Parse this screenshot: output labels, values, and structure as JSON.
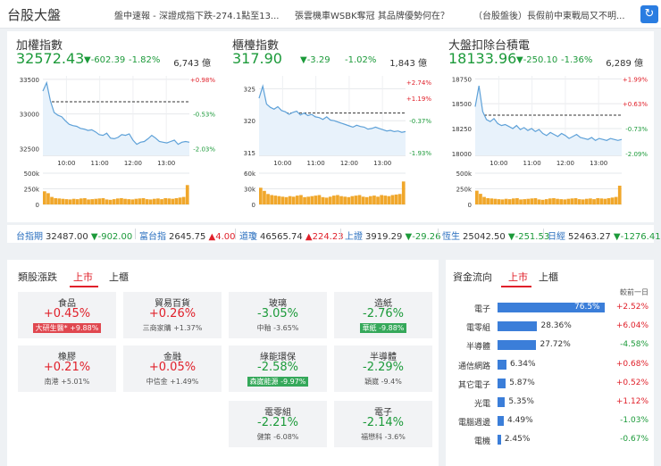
{
  "header": {
    "title": "台股大盤",
    "news": [
      "盤中速報 - 深證成指下跌-274.1點至13...",
      "張雲機車WSBK奪冠 其品牌優勢何在？",
      "（台股盤後）長假前中東戰局又不明..."
    ],
    "refresh_icon": "refresh-icon"
  },
  "panels": [
    {
      "name": "加權指數",
      "price": "32572.43",
      "change": "▼-602.39",
      "percent": "-1.82%",
      "volume": "6,743 億",
      "chart": {
        "ylim": [
          32400,
          33550
        ],
        "prev_close": 33175,
        "y_ticks": [
          {
            "v": 33500,
            "l": "33500"
          },
          {
            "v": 33000,
            "l": "33000"
          },
          {
            "v": 32500,
            "l": "32500"
          }
        ],
        "r_ticks": [
          {
            "v": 33500,
            "l": "+0.98%",
            "c": "up"
          },
          {
            "v": 33000,
            "l": "-0.53%",
            "c": "down"
          },
          {
            "v": 32500,
            "l": "-2.03%",
            "c": "down"
          }
        ],
        "x_ticks": [
          "10:00",
          "11:00",
          "12:00",
          "13:00"
        ],
        "vol_ticks": [
          "500k",
          "250k",
          "0"
        ],
        "vol_max": 500,
        "series": [
          33330,
          33450,
          33190,
          33020,
          32980,
          32960,
          32900,
          32850,
          32830,
          32820,
          32790,
          32780,
          32760,
          32770,
          32740,
          32700,
          32690,
          32720,
          32650,
          32640,
          32660,
          32700,
          32690,
          32710,
          32620,
          32560,
          32590,
          32600,
          32640,
          32690,
          32650,
          32600,
          32590,
          32580,
          32600,
          32620,
          32560,
          32590,
          32600,
          32590
        ],
        "volume": [
          210,
          180,
          120,
          100,
          95,
          90,
          85,
          80,
          90,
          85,
          95,
          100,
          80,
          85,
          90,
          95,
          100,
          80,
          75,
          85,
          95,
          100,
          90,
          85,
          80,
          90,
          95,
          100,
          85,
          80,
          90,
          95,
          85,
          100,
          95,
          90,
          100,
          110,
          120,
          310
        ]
      }
    },
    {
      "name": "櫃檯指數",
      "price": "317.90",
      "change": "▼-3.29",
      "percent": "-1.02%",
      "volume": "1,843 億",
      "chart": {
        "ylim": [
          314.6,
          327
        ],
        "prev_close": 321.2,
        "y_ticks": [
          {
            "v": 325,
            "l": "325"
          },
          {
            "v": 320,
            "l": "320"
          },
          {
            "v": 315,
            "l": "315"
          }
        ],
        "r_ticks": [
          {
            "v": 326,
            "l": "+2.74%",
            "c": "up"
          },
          {
            "v": 323.5,
            "l": "+1.19%",
            "c": "up"
          },
          {
            "v": 320,
            "l": "-0.37%",
            "c": "down"
          },
          {
            "v": 315,
            "l": "-1.93%",
            "c": "down"
          }
        ],
        "x_ticks": [
          "10:00",
          "11:00",
          "12:00",
          "13:00"
        ],
        "vol_ticks": [
          "60k",
          "30k",
          "0"
        ],
        "vol_max": 60,
        "series": [
          323.5,
          325.4,
          322.6,
          322.1,
          321.8,
          322.2,
          321.6,
          321.4,
          321.0,
          321.3,
          321.5,
          320.9,
          321.2,
          320.8,
          321.0,
          320.6,
          320.5,
          320.2,
          320.6,
          320.1,
          320.0,
          319.8,
          319.6,
          319.4,
          319.2,
          319.0,
          319.3,
          319.1,
          319.0,
          318.7,
          318.8,
          319.0,
          318.8,
          318.6,
          318.4,
          318.5,
          318.3,
          318.4,
          318.2,
          318.3
        ],
        "volume": [
          32,
          26,
          20,
          18,
          17,
          16,
          15,
          14,
          16,
          15,
          17,
          18,
          14,
          15,
          16,
          17,
          18,
          14,
          13,
          15,
          17,
          18,
          16,
          15,
          14,
          16,
          17,
          18,
          15,
          14,
          16,
          17,
          15,
          18,
          17,
          16,
          18,
          19,
          20,
          44
        ]
      }
    },
    {
      "name": "大盤扣除台積電",
      "price": "18133.96",
      "change": "▼-250.10",
      "percent": "-1.36%",
      "volume": "6,289 億",
      "chart": {
        "ylim": [
          17980,
          18780
        ],
        "prev_close": 18385,
        "y_ticks": [
          {
            "v": 18750,
            "l": "18750"
          },
          {
            "v": 18500,
            "l": "18500"
          },
          {
            "v": 18250,
            "l": "18250"
          },
          {
            "v": 18000,
            "l": "18000"
          }
        ],
        "r_ticks": [
          {
            "v": 18750,
            "l": "+1.99%",
            "c": "up"
          },
          {
            "v": 18500,
            "l": "+0.63%",
            "c": "up"
          },
          {
            "v": 18250,
            "l": "-0.73%",
            "c": "down"
          },
          {
            "v": 18000,
            "l": "-2.09%",
            "c": "down"
          }
        ],
        "x_ticks": [
          "10:00",
          "11:00",
          "12:00",
          "13:00"
        ],
        "vol_ticks": [
          "500k",
          "250k",
          "0"
        ],
        "vol_max": 500,
        "series": [
          18470,
          18680,
          18420,
          18340,
          18320,
          18350,
          18300,
          18280,
          18290,
          18270,
          18250,
          18280,
          18240,
          18260,
          18230,
          18250,
          18220,
          18240,
          18200,
          18180,
          18210,
          18190,
          18170,
          18200,
          18180,
          18150,
          18170,
          18190,
          18160,
          18150,
          18140,
          18160,
          18130,
          18150,
          18140,
          18130,
          18150,
          18140,
          18130,
          18140
        ],
        "volume": [
          220,
          170,
          120,
          100,
          95,
          90,
          85,
          80,
          90,
          85,
          95,
          100,
          80,
          85,
          90,
          95,
          100,
          80,
          75,
          85,
          95,
          100,
          90,
          85,
          80,
          90,
          95,
          100,
          85,
          80,
          90,
          95,
          85,
          100,
          95,
          90,
          100,
          110,
          120,
          300
        ]
      }
    }
  ],
  "strip": [
    {
      "label": "台指期",
      "value": "32487.00",
      "change": "▼-902.00",
      "dir": "down"
    },
    {
      "label": "富台指",
      "value": "2645.75",
      "change": "▲4.00",
      "dir": "up"
    },
    {
      "label": "道瓊",
      "value": "46565.74",
      "change": "▲224.23",
      "dir": "up"
    },
    {
      "label": "上證",
      "value": "3919.29",
      "change": "▼-29.26",
      "dir": "down"
    },
    {
      "label": "恆生",
      "value": "25042.50",
      "change": "▼-251.53",
      "dir": "down"
    },
    {
      "label": "日經",
      "value": "52463.27",
      "change": "▼-1276.41",
      "dir": "down"
    }
  ],
  "sectors": {
    "title": "類股漲跌",
    "tabs": [
      "上市",
      "上櫃"
    ],
    "cards": [
      {
        "name": "食品",
        "pct": "+0.45%",
        "dir": "up",
        "stock": "大研生醫*",
        "stock_chg": "+9.88%",
        "badge": true
      },
      {
        "name": "貿易百貨",
        "pct": "+0.26%",
        "dir": "up",
        "stock": "三商家購",
        "stock_chg": "+1.37%",
        "badge": false
      },
      {
        "name": "玻璃",
        "pct": "-3.05%",
        "dir": "down",
        "stock": "中釉",
        "stock_chg": "-3.65%",
        "badge": false
      },
      {
        "name": "造紙",
        "pct": "-2.76%",
        "dir": "down",
        "stock": "華紙",
        "stock_chg": "-9.88%",
        "badge": true
      },
      {
        "name": "橡膠",
        "pct": "+0.21%",
        "dir": "up",
        "stock": "南港",
        "stock_chg": "+5.01%",
        "badge": false
      },
      {
        "name": "金融",
        "pct": "+0.05%",
        "dir": "up",
        "stock": "中信金",
        "stock_chg": "+1.49%",
        "badge": false
      },
      {
        "name": "綠能環保",
        "pct": "-2.58%",
        "dir": "down",
        "stock": "森崴能源",
        "stock_chg": "-9.97%",
        "badge": true
      },
      {
        "name": "半導體",
        "pct": "-2.29%",
        "dir": "down",
        "stock": "穎崴",
        "stock_chg": "-9.4%",
        "badge": false
      },
      {
        "name": "電零組",
        "pct": "-2.21%",
        "dir": "down",
        "stock": "健策",
        "stock_chg": "-6.08%",
        "badge": false
      },
      {
        "name": "電子",
        "pct": "-2.14%",
        "dir": "down",
        "stock": "福懋科",
        "stock_chg": "-3.6%",
        "badge": false
      }
    ]
  },
  "flow": {
    "title": "資金流向",
    "tabs": [
      "上市",
      "上櫃"
    ],
    "unit": "較前一日",
    "rows": [
      {
        "name": "電子",
        "pct": 76.5,
        "pct_label": "76.5%",
        "change": "+2.52%",
        "dir": "up"
      },
      {
        "name": "電零組",
        "pct": 28.36,
        "pct_label": "28.36%",
        "change": "+6.04%",
        "dir": "up"
      },
      {
        "name": "半導體",
        "pct": 27.72,
        "pct_label": "27.72%",
        "change": "-4.58%",
        "dir": "down"
      },
      {
        "name": "通信網路",
        "pct": 6.34,
        "pct_label": "6.34%",
        "change": "+0.68%",
        "dir": "up"
      },
      {
        "name": "其它電子",
        "pct": 5.87,
        "pct_label": "5.87%",
        "change": "+0.52%",
        "dir": "up"
      },
      {
        "name": "光電",
        "pct": 5.35,
        "pct_label": "5.35%",
        "change": "+1.12%",
        "dir": "up"
      },
      {
        "name": "電腦週邊",
        "pct": 4.49,
        "pct_label": "4.49%",
        "change": "-1.03%",
        "dir": "down"
      },
      {
        "name": "電機",
        "pct": 2.45,
        "pct_label": "2.45%",
        "change": "-0.67%",
        "dir": "down"
      }
    ]
  }
}
